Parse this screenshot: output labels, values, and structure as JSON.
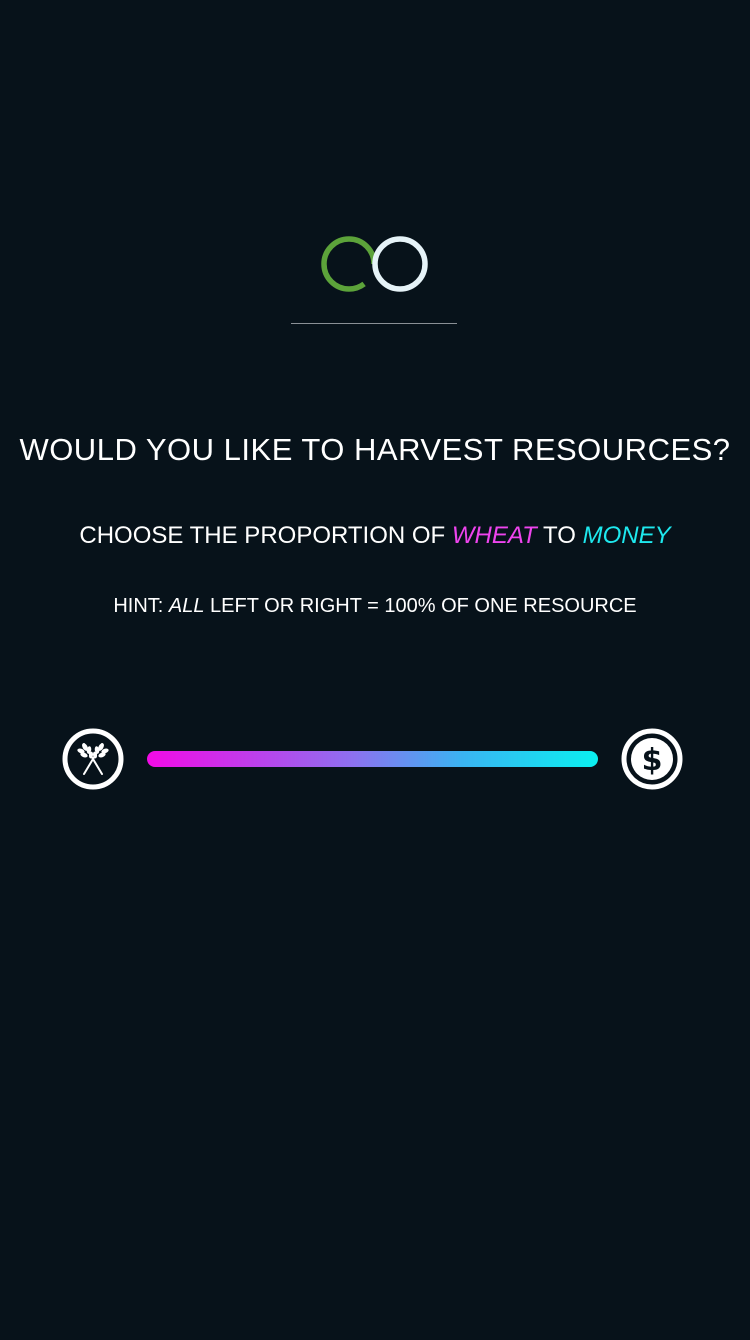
{
  "logo": {
    "icon": "co-logo-icon",
    "left_ring_color": "#5ca33a",
    "right_ring_color": "#e6f3f8"
  },
  "prompt": {
    "heading": "WOULD YOU LIKE TO HARVEST RESOURCES?",
    "subheading_prefix": "CHOOSE THE PROPORTION OF ",
    "resource_a": "WHEAT",
    "subheading_mid": " TO ",
    "resource_b": "MONEY",
    "hint_prefix": "HINT: ",
    "hint_emphasis": "ALL",
    "hint_rest": " LEFT OR RIGHT = 100% OF ONE RESOURCE"
  },
  "slider": {
    "left_icon": "wheat-icon",
    "right_icon": "dollar-icon",
    "gradient_start_color": "#f20ae6",
    "gradient_end_color": "#0af0f0"
  },
  "colors": {
    "background": "#07121a",
    "wheat_accent": "#ee44ee",
    "money_accent": "#1ee8ee"
  }
}
